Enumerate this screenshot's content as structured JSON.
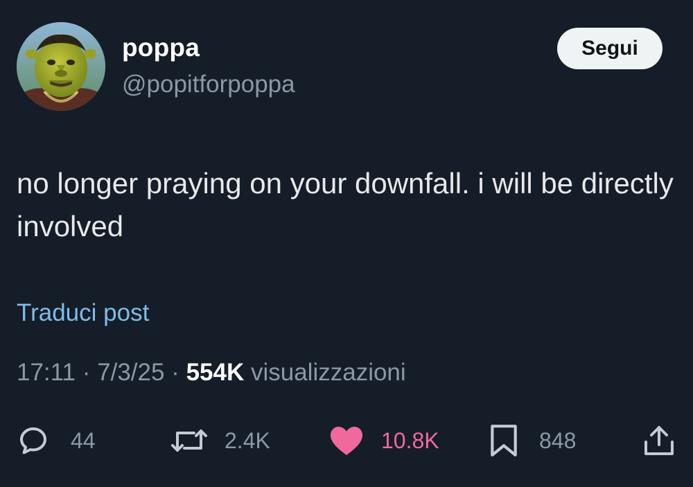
{
  "user": {
    "display_name": "poppa",
    "handle": "@popitforpoppa",
    "avatar_icon": "profile-avatar-green-ogre-face"
  },
  "follow_button": {
    "label": "Segui"
  },
  "tweet": {
    "text": "no longer praying on your downfall. i will be directly involved"
  },
  "translate": {
    "label": "Traduci post"
  },
  "meta": {
    "time": "17:11",
    "separator": "·",
    "date": "7/3/25",
    "views_count": "554K",
    "views_label": "visualizzazioni"
  },
  "actions": {
    "replies": {
      "icon": "reply-icon",
      "count": "44"
    },
    "reposts": {
      "icon": "repost-icon",
      "count": "2.4K"
    },
    "likes": {
      "icon": "heart-icon",
      "count": "10.8K",
      "active": true
    },
    "bookmarks": {
      "icon": "bookmark-icon",
      "count": "848"
    },
    "share": {
      "icon": "share-icon"
    }
  },
  "colors": {
    "background": "#151d28",
    "text_primary": "#e7e9ea",
    "text_secondary": "#8b98a5",
    "link": "#7fbde8",
    "like_active": "#f0699d",
    "button_bg": "#eff3f4"
  }
}
